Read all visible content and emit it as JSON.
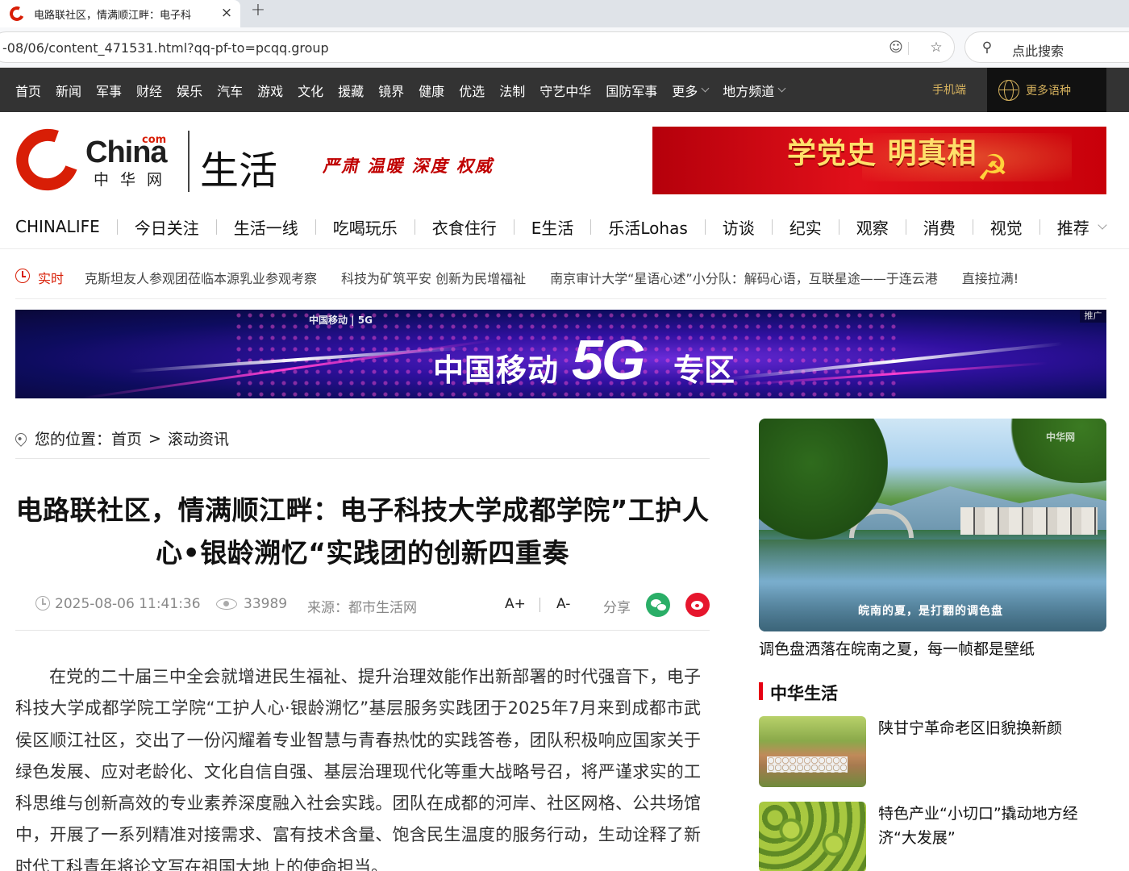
{
  "browser": {
    "tab_title": "电路联社区，情满顺江畔：电子科",
    "url": "-08/06/content_471531.html?qq-pf-to=pcqq.group",
    "search_placeholder": "点此搜索",
    "new_tab_symbol": "+",
    "close_symbol": "×"
  },
  "topnav": {
    "items": [
      "首页",
      "新闻",
      "军事",
      "财经",
      "娱乐",
      "汽车",
      "游戏",
      "文化",
      "援藏",
      "镜界",
      "健康",
      "优选",
      "法制",
      "守艺中华",
      "国防军事",
      "更多",
      "地方频道"
    ],
    "mobile": "手机端",
    "languages": "更多语种"
  },
  "logo": {
    "brand": "China",
    "com": "com",
    "cn": "中华网",
    "section": "生活",
    "slogan": "严肃 温暖 深度 权威"
  },
  "top_banner": {
    "text": "学党史 明真相"
  },
  "channelnav": {
    "items": [
      "CHINALIFE",
      "今日关注",
      "生活一线",
      "吃喝玩乐",
      "衣食住行",
      "E生活",
      "乐活Lohas",
      "访谈",
      "纪实",
      "观察",
      "消费",
      "视觉",
      "推荐"
    ]
  },
  "ticker": {
    "label": "实时",
    "items": [
      "克斯坦友人参观团莅临本源乳业参观考察",
      "科技为矿筑平安 创新为民增福祉",
      "南京审计大学“星语心述”小分队：解码心语，互联星途——于连云港",
      "直接拉满!"
    ]
  },
  "ad_banner": {
    "brand": "中国移动 | 5G",
    "text_a": "中国移动",
    "text_b": "5G",
    "text_c": "专区",
    "tag": "推广"
  },
  "breadcrumb": {
    "label": "您的位置：",
    "home": "首页",
    "sep": ">",
    "current": "滚动资讯"
  },
  "article": {
    "title": "电路联社区，情满顺江畔：电子科技大学成都学院”工护人心•银龄溯忆“实践团的创新四重奏",
    "date": "2025-08-06 11:41:36",
    "views": "33989",
    "source": "来源：都市生活网",
    "font_up": "A+",
    "font_down": "A-",
    "share": "分享",
    "body": "在党的二十届三中全会就增进民生福祉、提升治理效能作出新部署的时代强音下，电子科技大学成都学院工学院“工护人心·银龄溯忆”基层服务实践团于2025年7月来到成都市武侯区顺江社区，交出了一份闪耀着专业智慧与青春热忱的实践答卷，团队积极响应国家关于绿色发展、应对老龄化、文化自信自强、基层治理现代化等重大战略号召，将严谨求实的工科思维与创新高效的专业素养深度融入社会实践。团队在成都的河岸、社区网格、公共场馆中，开展了一系列精准对接需求、富有技术含量、饱含民生温度的服务行动，生动诠释了新时代工科青年将论文写在祖国大地上的使命担当。"
  },
  "sidebar": {
    "feature_caption_on_image": "皖南的夏，是打翻的调色盘",
    "feature_watermark": "中华网",
    "feature_title": "调色盘洒落在皖南之夏，每一帧都是壁纸",
    "section_title": "中华生活",
    "news": [
      {
        "title": "陕甘宁革命老区旧貌换新颜"
      },
      {
        "title": "特色产业“小切口”撬动地方经济“大发展”"
      }
    ]
  }
}
